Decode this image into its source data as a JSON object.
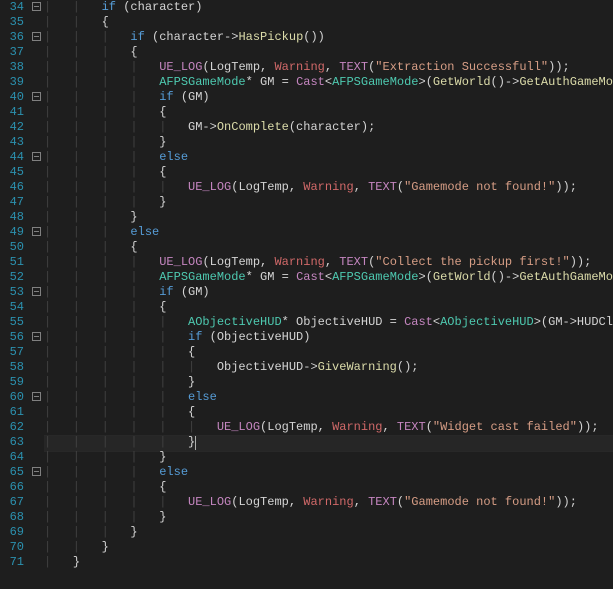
{
  "editor": {
    "lineNumbers": [
      "34",
      "35",
      "36",
      "37",
      "38",
      "39",
      "40",
      "41",
      "42",
      "43",
      "44",
      "45",
      "46",
      "47",
      "48",
      "49",
      "50",
      "51",
      "52",
      "53",
      "54",
      "55",
      "56",
      "57",
      "58",
      "59",
      "60",
      "61",
      "62",
      "63",
      "64",
      "65",
      "66",
      "67",
      "68",
      "69",
      "70",
      "71"
    ],
    "fold": {
      "34": "minus",
      "36": "minus",
      "40": "minus",
      "44": "minus",
      "49": "minus",
      "53": "minus",
      "56": "minus",
      "60": "minus",
      "65": "minus"
    },
    "code": {
      "l34": {
        "kw": "if",
        "rest": " (character)"
      },
      "l35": {
        "brace": "{"
      },
      "l36": {
        "kw": "if",
        "rest1": " (character->",
        "fn": "HasPickup",
        "rest2": "())"
      },
      "l37": {
        "brace": "{"
      },
      "l38": {
        "ue": "UE_LOG",
        "p1": "(LogTemp, ",
        "warn": "Warning",
        "p2": ", ",
        "text": "TEXT",
        "p3": "(",
        "str": "\"Extraction Successfull\"",
        "p4": "));"
      },
      "l39": {
        "type1": "AFPSGameMode",
        "star": "* GM = ",
        "cast": "Cast",
        "lt": "<",
        "type2": "AFPSGameMode",
        "gt": ">(",
        "getw": "GetWorld",
        "arrow": "()->",
        "getauth": "GetAuthGameMode",
        "end": "());"
      },
      "l40": {
        "kw": "if",
        "rest": " (GM)"
      },
      "l41": {
        "brace": "{"
      },
      "l42": {
        "pre": "GM->",
        "fn": "OnComplete",
        "post": "(character);"
      },
      "l43": {
        "brace": "}"
      },
      "l44": {
        "kw": "else"
      },
      "l45": {
        "brace": "{"
      },
      "l46": {
        "ue": "UE_LOG",
        "p1": "(LogTemp, ",
        "warn": "Warning",
        "p2": ", ",
        "text": "TEXT",
        "p3": "(",
        "str": "\"Gamemode not found!\"",
        "p4": "));"
      },
      "l47": {
        "brace": "}"
      },
      "l48": {
        "brace": "}"
      },
      "l49": {
        "kw": "else"
      },
      "l50": {
        "brace": "{"
      },
      "l51": {
        "ue": "UE_LOG",
        "p1": "(LogTemp, ",
        "warn": "Warning",
        "p2": ", ",
        "text": "TEXT",
        "p3": "(",
        "str": "\"Collect the pickup first!\"",
        "p4": "));"
      },
      "l52": {
        "type1": "AFPSGameMode",
        "star": "* GM = ",
        "cast": "Cast",
        "lt": "<",
        "type2": "AFPSGameMode",
        "gt": ">(",
        "getw": "GetWorld",
        "arrow": "()->",
        "getauth": "GetAuthGameMode",
        "end": "());"
      },
      "l53": {
        "kw": "if",
        "rest": " (GM)"
      },
      "l54": {
        "brace": "{"
      },
      "l55": {
        "type1": "AObjectiveHUD",
        "star": "* ObjectiveHUD = ",
        "cast": "Cast",
        "lt": "<",
        "type2": "AObjectiveHUD",
        "gt": ">(GM->HUDClass);"
      },
      "l56": {
        "kw": "if",
        "rest": " (ObjectiveHUD)"
      },
      "l57": {
        "brace": "{"
      },
      "l58": {
        "pre": "ObjectiveHUD->",
        "fn": "GiveWarning",
        "post": "();"
      },
      "l59": {
        "brace": "}"
      },
      "l60": {
        "kw": "else"
      },
      "l61": {
        "brace": "{"
      },
      "l62": {
        "ue": "UE_LOG",
        "p1": "(LogTemp, ",
        "warn": "Warning",
        "p2": ", ",
        "text": "TEXT",
        "p3": "(",
        "str": "\"Widget cast failed\"",
        "p4": "));"
      },
      "l63": {
        "brace": "}"
      },
      "l64": {
        "brace": "}"
      },
      "l65": {
        "kw": "else"
      },
      "l66": {
        "brace": "{"
      },
      "l67": {
        "ue": "UE_LOG",
        "p1": "(LogTemp, ",
        "warn": "Warning",
        "p2": ", ",
        "text": "TEXT",
        "p3": "(",
        "str": "\"Gamemode not found!\"",
        "p4": "));"
      },
      "l68": {
        "brace": "}"
      },
      "l69": {
        "brace": "}"
      },
      "l70": {
        "brace": "}"
      },
      "l71": {
        "brace": "}"
      }
    },
    "indent": {
      "l34": 2,
      "l35": 2,
      "l36": 3,
      "l37": 3,
      "l38": 4,
      "l39": 4,
      "l40": 4,
      "l41": 4,
      "l42": 5,
      "l43": 4,
      "l44": 4,
      "l45": 4,
      "l46": 5,
      "l47": 4,
      "l48": 3,
      "l49": 3,
      "l50": 3,
      "l51": 4,
      "l52": 4,
      "l53": 4,
      "l54": 4,
      "l55": 5,
      "l56": 5,
      "l57": 5,
      "l58": 6,
      "l59": 5,
      "l60": 5,
      "l61": 5,
      "l62": 6,
      "l63": 5,
      "l64": 4,
      "l65": 4,
      "l66": 4,
      "l67": 5,
      "l68": 4,
      "l69": 3,
      "l70": 2,
      "l71": 1
    },
    "currentLine": 63
  }
}
